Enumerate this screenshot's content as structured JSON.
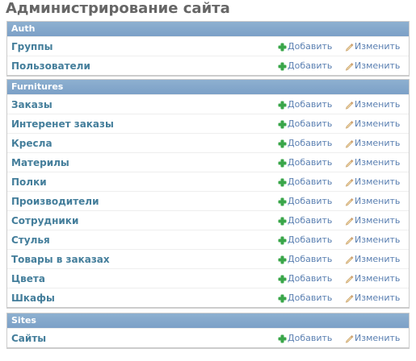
{
  "page": {
    "title": "Администрирование сайта"
  },
  "colors": {
    "caption_bg": "#7ca0c7",
    "model_link": "#447e9b",
    "action_link": "#5b80b2",
    "add_icon": "#3aa64a",
    "change_icon": "#c9a26b"
  },
  "icons": {
    "add": "plus-icon",
    "change": "pencil-icon"
  },
  "actions": {
    "add_label": "Добавить",
    "change_label": "Изменить"
  },
  "modules": [
    {
      "caption": "Auth",
      "models": [
        {
          "name": "Группы"
        },
        {
          "name": "Пользователи"
        }
      ]
    },
    {
      "caption": "Furnitures",
      "models": [
        {
          "name": "Заказы"
        },
        {
          "name": "Интеренет заказы"
        },
        {
          "name": "Кресла"
        },
        {
          "name": "Материлы"
        },
        {
          "name": "Полки"
        },
        {
          "name": "Производители"
        },
        {
          "name": "Сотрудники"
        },
        {
          "name": "Стулья"
        },
        {
          "name": "Товары в заказах"
        },
        {
          "name": "Цвета"
        },
        {
          "name": "Шкафы"
        }
      ]
    },
    {
      "caption": "Sites",
      "models": [
        {
          "name": "Сайты"
        }
      ]
    }
  ]
}
